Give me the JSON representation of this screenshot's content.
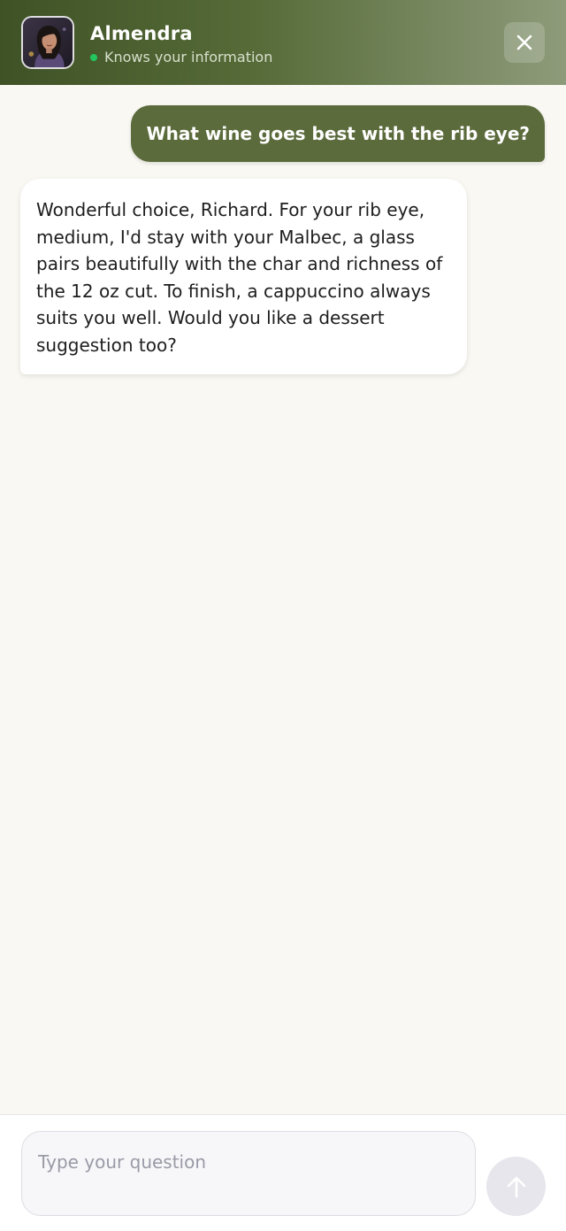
{
  "header": {
    "name": "Almendra",
    "status_text": "Knows your information",
    "status_color": "#22c55e",
    "avatar_icon": "avatar-portrait-icon",
    "close_icon": "close-icon",
    "gradient_colors": [
      "#3f5226",
      "#566b38",
      "#7a8a63",
      "#8e9b7a"
    ]
  },
  "messages": [
    {
      "role": "user",
      "text": "What wine goes best with the rib eye?"
    },
    {
      "role": "assistant",
      "text": "Wonderful choice, Richard. For your rib eye, medium, I'd stay with your Malbec, a glass pairs beautifully with the char and richness of the 12 oz cut. To finish, a cappuccino always suits you well. Would you like a dessert suggestion too?"
    }
  ],
  "composer": {
    "placeholder": "Type your question",
    "value": "",
    "send_icon": "arrow-up-icon"
  },
  "colors": {
    "background": "#f9f8f2",
    "user_bubble": "#5b6b3c",
    "assistant_bubble": "#ffffff"
  }
}
